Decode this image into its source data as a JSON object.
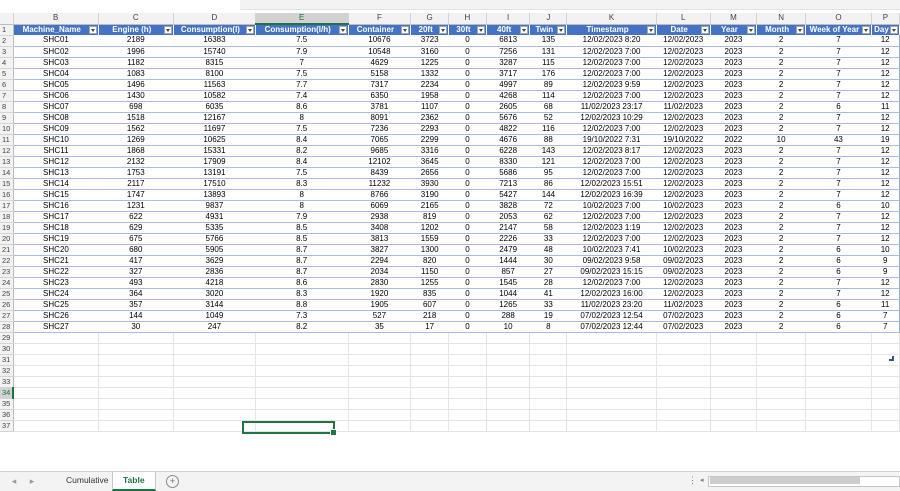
{
  "columns": [
    "B",
    "C",
    "D",
    "E",
    "F",
    "G",
    "H",
    "I",
    "J",
    "K",
    "L",
    "M",
    "N",
    "O",
    "P"
  ],
  "selected_column": "E",
  "selected_row": 34,
  "headers": [
    "Machine_Name",
    "Engine (h)",
    "Consumption(l)",
    "Consumption(l/h)",
    "Container",
    "20ft",
    "30ft",
    "40ft",
    "Twin",
    "Timestamp",
    "Date",
    "Year",
    "Month",
    "Week of Year",
    "Day"
  ],
  "rows": [
    [
      "SHC01",
      "2189",
      "16383",
      "7.5",
      "10676",
      "3723",
      "0",
      "6813",
      "135",
      "12/02/2023 8:20",
      "12/02/2023",
      "2023",
      "2",
      "7",
      "12"
    ],
    [
      "SHC02",
      "1996",
      "15740",
      "7.9",
      "10548",
      "3160",
      "0",
      "7256",
      "131",
      "12/02/2023 7:00",
      "12/02/2023",
      "2023",
      "2",
      "7",
      "12"
    ],
    [
      "SHC03",
      "1182",
      "8315",
      "7",
      "4629",
      "1225",
      "0",
      "3287",
      "115",
      "12/02/2023 7:00",
      "12/02/2023",
      "2023",
      "2",
      "7",
      "12"
    ],
    [
      "SHC04",
      "1083",
      "8100",
      "7.5",
      "5158",
      "1332",
      "0",
      "3717",
      "176",
      "12/02/2023 7:00",
      "12/02/2023",
      "2023",
      "2",
      "7",
      "12"
    ],
    [
      "SHC05",
      "1496",
      "11563",
      "7.7",
      "7317",
      "2234",
      "0",
      "4997",
      "89",
      "12/02/2023 9:59",
      "12/02/2023",
      "2023",
      "2",
      "7",
      "12"
    ],
    [
      "SHC06",
      "1430",
      "10582",
      "7.4",
      "6350",
      "1958",
      "0",
      "4268",
      "114",
      "12/02/2023 7:00",
      "12/02/2023",
      "2023",
      "2",
      "7",
      "12"
    ],
    [
      "SHC07",
      "698",
      "6035",
      "8.6",
      "3781",
      "1107",
      "0",
      "2605",
      "68",
      "11/02/2023 23:17",
      "11/02/2023",
      "2023",
      "2",
      "6",
      "11"
    ],
    [
      "SHC08",
      "1518",
      "12167",
      "8",
      "8091",
      "2362",
      "0",
      "5676",
      "52",
      "12/02/2023 10:29",
      "12/02/2023",
      "2023",
      "2",
      "7",
      "12"
    ],
    [
      "SHC09",
      "1562",
      "11697",
      "7.5",
      "7236",
      "2293",
      "0",
      "4822",
      "116",
      "12/02/2023 7:00",
      "12/02/2023",
      "2023",
      "2",
      "7",
      "12"
    ],
    [
      "SHC10",
      "1269",
      "10625",
      "8.4",
      "7065",
      "2299",
      "0",
      "4676",
      "88",
      "19/10/2022 7:31",
      "19/10/2022",
      "2022",
      "10",
      "43",
      "19"
    ],
    [
      "SHC11",
      "1868",
      "15331",
      "8.2",
      "9685",
      "3316",
      "0",
      "6228",
      "143",
      "12/02/2023 8:17",
      "12/02/2023",
      "2023",
      "2",
      "7",
      "12"
    ],
    [
      "SHC12",
      "2132",
      "17909",
      "8.4",
      "12102",
      "3645",
      "0",
      "8330",
      "121",
      "12/02/2023 7:00",
      "12/02/2023",
      "2023",
      "2",
      "7",
      "12"
    ],
    [
      "SHC13",
      "1753",
      "13191",
      "7.5",
      "8439",
      "2656",
      "0",
      "5686",
      "95",
      "12/02/2023 7:00",
      "12/02/2023",
      "2023",
      "2",
      "7",
      "12"
    ],
    [
      "SHC14",
      "2117",
      "17510",
      "8.3",
      "11232",
      "3930",
      "0",
      "7213",
      "86",
      "12/02/2023 15:51",
      "12/02/2023",
      "2023",
      "2",
      "7",
      "12"
    ],
    [
      "SHC15",
      "1747",
      "13893",
      "8",
      "8766",
      "3190",
      "0",
      "5427",
      "144",
      "12/02/2023 16:39",
      "12/02/2023",
      "2023",
      "2",
      "7",
      "12"
    ],
    [
      "SHC16",
      "1231",
      "9837",
      "8",
      "6069",
      "2165",
      "0",
      "3828",
      "72",
      "10/02/2023 7:00",
      "10/02/2023",
      "2023",
      "2",
      "6",
      "10"
    ],
    [
      "SHC17",
      "622",
      "4931",
      "7.9",
      "2938",
      "819",
      "0",
      "2053",
      "62",
      "12/02/2023 7:00",
      "12/02/2023",
      "2023",
      "2",
      "7",
      "12"
    ],
    [
      "SHC18",
      "629",
      "5335",
      "8.5",
      "3408",
      "1202",
      "0",
      "2147",
      "58",
      "12/02/2023 1:19",
      "12/02/2023",
      "2023",
      "2",
      "7",
      "12"
    ],
    [
      "SHC19",
      "675",
      "5766",
      "8.5",
      "3813",
      "1559",
      "0",
      "2226",
      "33",
      "12/02/2023 7:00",
      "12/02/2023",
      "2023",
      "2",
      "7",
      "12"
    ],
    [
      "SHC20",
      "680",
      "5905",
      "8.7",
      "3827",
      "1300",
      "0",
      "2479",
      "48",
      "10/02/2023 7:41",
      "10/02/2023",
      "2023",
      "2",
      "6",
      "10"
    ],
    [
      "SHC21",
      "417",
      "3629",
      "8.7",
      "2294",
      "820",
      "0",
      "1444",
      "30",
      "09/02/2023 9:58",
      "09/02/2023",
      "2023",
      "2",
      "6",
      "9"
    ],
    [
      "SHC22",
      "327",
      "2836",
      "8.7",
      "2034",
      "1150",
      "0",
      "857",
      "27",
      "09/02/2023 15:15",
      "09/02/2023",
      "2023",
      "2",
      "6",
      "9"
    ],
    [
      "SHC23",
      "493",
      "4218",
      "8.6",
      "2830",
      "1255",
      "0",
      "1545",
      "28",
      "12/02/2023 7:00",
      "12/02/2023",
      "2023",
      "2",
      "7",
      "12"
    ],
    [
      "SHC24",
      "364",
      "3020",
      "8.3",
      "1920",
      "835",
      "0",
      "1044",
      "41",
      "12/02/2023 16:00",
      "12/02/2023",
      "2023",
      "2",
      "7",
      "12"
    ],
    [
      "SHC25",
      "357",
      "3144",
      "8.8",
      "1905",
      "607",
      "0",
      "1265",
      "33",
      "11/02/2023 23:20",
      "11/02/2023",
      "2023",
      "2",
      "6",
      "11"
    ],
    [
      "SHC26",
      "144",
      "1049",
      "7.3",
      "527",
      "218",
      "0",
      "288",
      "19",
      "07/02/2023 12:54",
      "07/02/2023",
      "2023",
      "2",
      "6",
      "7"
    ],
    [
      "SHC27",
      "30",
      "247",
      "8.2",
      "35",
      "17",
      "0",
      "10",
      "8",
      "07/02/2023 12:44",
      "07/02/2023",
      "2023",
      "2",
      "6",
      "7"
    ]
  ],
  "empty_rows": [
    29,
    30,
    31,
    32,
    33,
    34,
    35,
    36,
    37
  ],
  "tabs": {
    "nav_prev": "◂",
    "nav_next": "▸",
    "sheet1": "Cumulative",
    "sheet2": "Table",
    "add": "+"
  },
  "colors": {
    "header_fill": "#4472c4",
    "accent": "#217346"
  }
}
